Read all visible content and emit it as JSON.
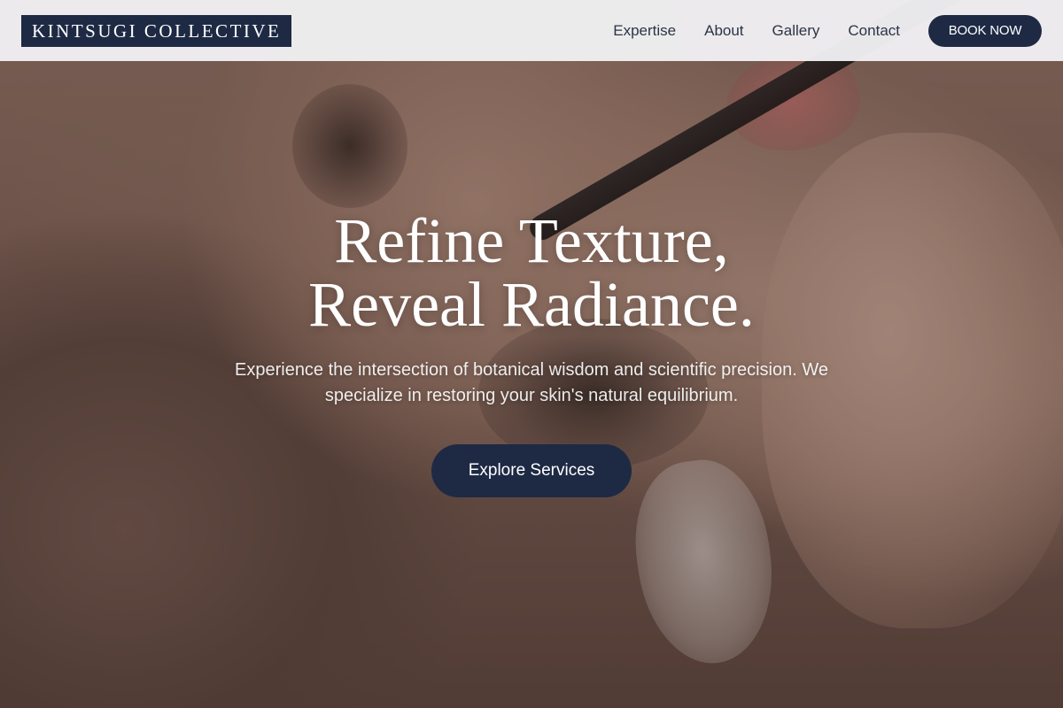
{
  "header": {
    "logo": "KINTSUGI COLLECTIVE",
    "nav": [
      {
        "label": "Expertise"
      },
      {
        "label": "About"
      },
      {
        "label": "Gallery"
      },
      {
        "label": "Contact"
      }
    ],
    "book_label": "BOOK NOW"
  },
  "hero": {
    "headline_line1": "Refine Texture,",
    "headline_line2": "Reveal Radiance.",
    "subtext": "Experience the intersection of botanical wisdom and scientific precision. We specialize in restoring your skin's natural equilibrium.",
    "cta_label": "Explore Services",
    "image_description_icon": "lash-extension-photo"
  },
  "colors": {
    "brand_navy": "#1e2a44",
    "header_bg": "#f0f0f2",
    "nav_text": "#2c3446"
  }
}
